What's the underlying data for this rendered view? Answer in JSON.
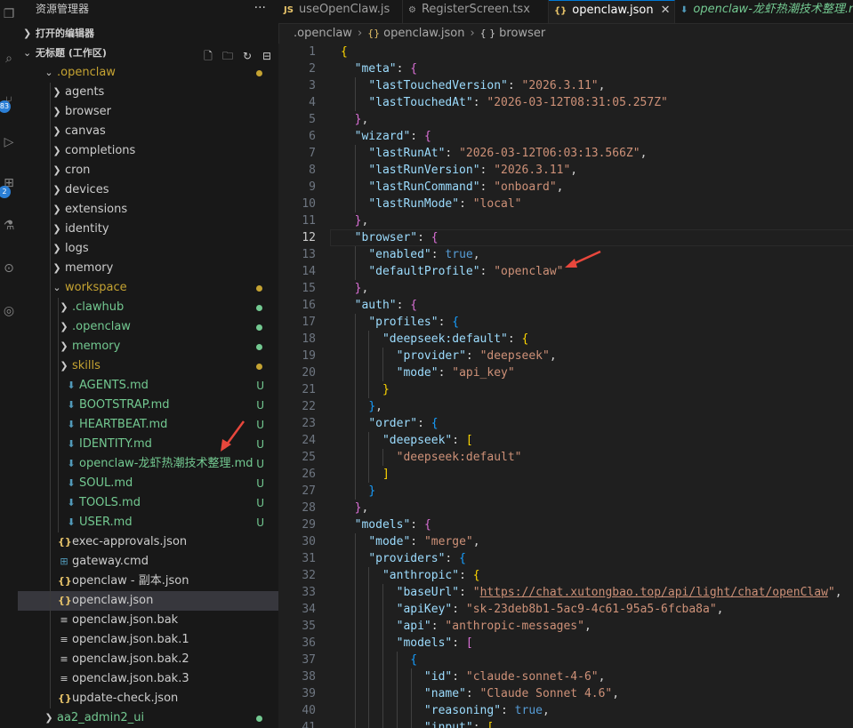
{
  "sidebar": {
    "title": "资源管理器",
    "more": "···",
    "open_editors": "打开的编辑器",
    "workspace": "无标题 (工作区)",
    "tree": [
      {
        "label": ".openclaw",
        "kind": "folder-open",
        "depth": 0,
        "decoration": "dot",
        "color": "#c5a332",
        "selected": false
      },
      {
        "label": "agents",
        "kind": "folder",
        "depth": 1
      },
      {
        "label": "browser",
        "kind": "folder",
        "depth": 1
      },
      {
        "label": "canvas",
        "kind": "folder",
        "depth": 1
      },
      {
        "label": "completions",
        "kind": "folder",
        "depth": 1
      },
      {
        "label": "cron",
        "kind": "folder",
        "depth": 1
      },
      {
        "label": "devices",
        "kind": "folder",
        "depth": 1
      },
      {
        "label": "extensions",
        "kind": "folder",
        "depth": 1
      },
      {
        "label": "identity",
        "kind": "folder",
        "depth": 1
      },
      {
        "label": "logs",
        "kind": "folder",
        "depth": 1
      },
      {
        "label": "memory",
        "kind": "folder",
        "depth": 1
      },
      {
        "label": "workspace",
        "kind": "folder-open",
        "depth": 1,
        "decoration": "dot",
        "color": "#c5a332"
      },
      {
        "label": ".clawhub",
        "kind": "folder",
        "depth": 2,
        "decoration": "dot",
        "color": "#73c991"
      },
      {
        "label": ".openclaw",
        "kind": "folder",
        "depth": 2,
        "decoration": "dot",
        "color": "#73c991"
      },
      {
        "label": "memory",
        "kind": "folder",
        "depth": 2,
        "decoration": "dot",
        "color": "#73c991"
      },
      {
        "label": "skills",
        "kind": "folder",
        "depth": 2,
        "decoration": "dot",
        "color": "#c5a332"
      },
      {
        "label": "AGENTS.md",
        "kind": "md",
        "depth": 2,
        "decoration": "U",
        "color": "#73c991"
      },
      {
        "label": "BOOTSTRAP.md",
        "kind": "md",
        "depth": 2,
        "decoration": "U",
        "color": "#73c991"
      },
      {
        "label": "HEARTBEAT.md",
        "kind": "md",
        "depth": 2,
        "decoration": "U",
        "color": "#73c991"
      },
      {
        "label": "IDENTITY.md",
        "kind": "md",
        "depth": 2,
        "decoration": "U",
        "color": "#73c991"
      },
      {
        "label": "openclaw-龙虾热潮技术整理.md",
        "kind": "md",
        "depth": 2,
        "decoration": "U",
        "color": "#73c991"
      },
      {
        "label": "SOUL.md",
        "kind": "md",
        "depth": 2,
        "decoration": "U",
        "color": "#73c991"
      },
      {
        "label": "TOOLS.md",
        "kind": "md",
        "depth": 2,
        "decoration": "U",
        "color": "#73c991"
      },
      {
        "label": "USER.md",
        "kind": "md",
        "depth": 2,
        "decoration": "U",
        "color": "#73c991"
      },
      {
        "label": "exec-approvals.json",
        "kind": "json",
        "depth": 1
      },
      {
        "label": "gateway.cmd",
        "kind": "cmd",
        "depth": 1
      },
      {
        "label": "openclaw - 副本.json",
        "kind": "json",
        "depth": 1
      },
      {
        "label": "openclaw.json",
        "kind": "json",
        "depth": 1,
        "selected": true
      },
      {
        "label": "openclaw.json.bak",
        "kind": "text",
        "depth": 1
      },
      {
        "label": "openclaw.json.bak.1",
        "kind": "text",
        "depth": 1
      },
      {
        "label": "openclaw.json.bak.2",
        "kind": "text",
        "depth": 1
      },
      {
        "label": "openclaw.json.bak.3",
        "kind": "text",
        "depth": 1
      },
      {
        "label": "update-check.json",
        "kind": "json",
        "depth": 1
      },
      {
        "label": "aa2_admin2_ui",
        "kind": "folder",
        "depth": 0,
        "decoration": "dot",
        "color": "#73c991"
      }
    ]
  },
  "activity": {
    "badge1": "83",
    "badge2": "2"
  },
  "tabs": [
    {
      "label": "useOpenClaw.js",
      "icon": "JS",
      "icon_color": "#e8c46a",
      "active": false
    },
    {
      "label": "RegisterScreen.tsx",
      "icon": "⚙",
      "icon_color": "#9d9d9d",
      "active": false
    },
    {
      "label": "openclaw.json",
      "icon": "{}",
      "icon_color": "#e8c46a",
      "active": true,
      "close": "✕"
    },
    {
      "label": "openclaw-龙虾热潮技术整理.md",
      "icon": "⬇",
      "icon_color": "#519aba",
      "active": false,
      "italic": true
    }
  ],
  "breadcrumb": [
    ".openclaw",
    "openclaw.json",
    "browser"
  ],
  "editor": {
    "current_line": 12,
    "lines": [
      "{",
      "  \"meta\": {",
      "    \"lastTouchedVersion\": \"2026.3.11\",",
      "    \"lastTouchedAt\": \"2026-03-12T08:31:05.257Z\"",
      "  },",
      "  \"wizard\": {",
      "    \"lastRunAt\": \"2026-03-12T06:03:13.566Z\",",
      "    \"lastRunVersion\": \"2026.3.11\",",
      "    \"lastRunCommand\": \"onboard\",",
      "    \"lastRunMode\": \"local\"",
      "  },",
      "  \"browser\": {",
      "    \"enabled\": true,",
      "    \"defaultProfile\": \"openclaw\"",
      "  },",
      "  \"auth\": {",
      "    \"profiles\": {",
      "      \"deepseek:default\": {",
      "        \"provider\": \"deepseek\",",
      "        \"mode\": \"api_key\"",
      "      }",
      "    },",
      "    \"order\": {",
      "      \"deepseek\": [",
      "        \"deepseek:default\"",
      "      ]",
      "    }",
      "  },",
      "  \"models\": {",
      "    \"mode\": \"merge\",",
      "    \"providers\": {",
      "      \"anthropic\": {",
      "        \"baseUrl\": \"https://chat.xutongbao.top/api/light/chat/openClaw\",",
      "        \"apiKey\": \"sk-23deb8b1-5ac9-4c61-95a5-6fcba8a\",",
      "        \"api\": \"anthropic-messages\",",
      "        \"models\": [",
      "          {",
      "            \"id\": \"claude-sonnet-4-6\",",
      "            \"name\": \"Claude Sonnet 4.6\",",
      "            \"reasoning\": true,",
      "            \"input\": ["
    ]
  }
}
